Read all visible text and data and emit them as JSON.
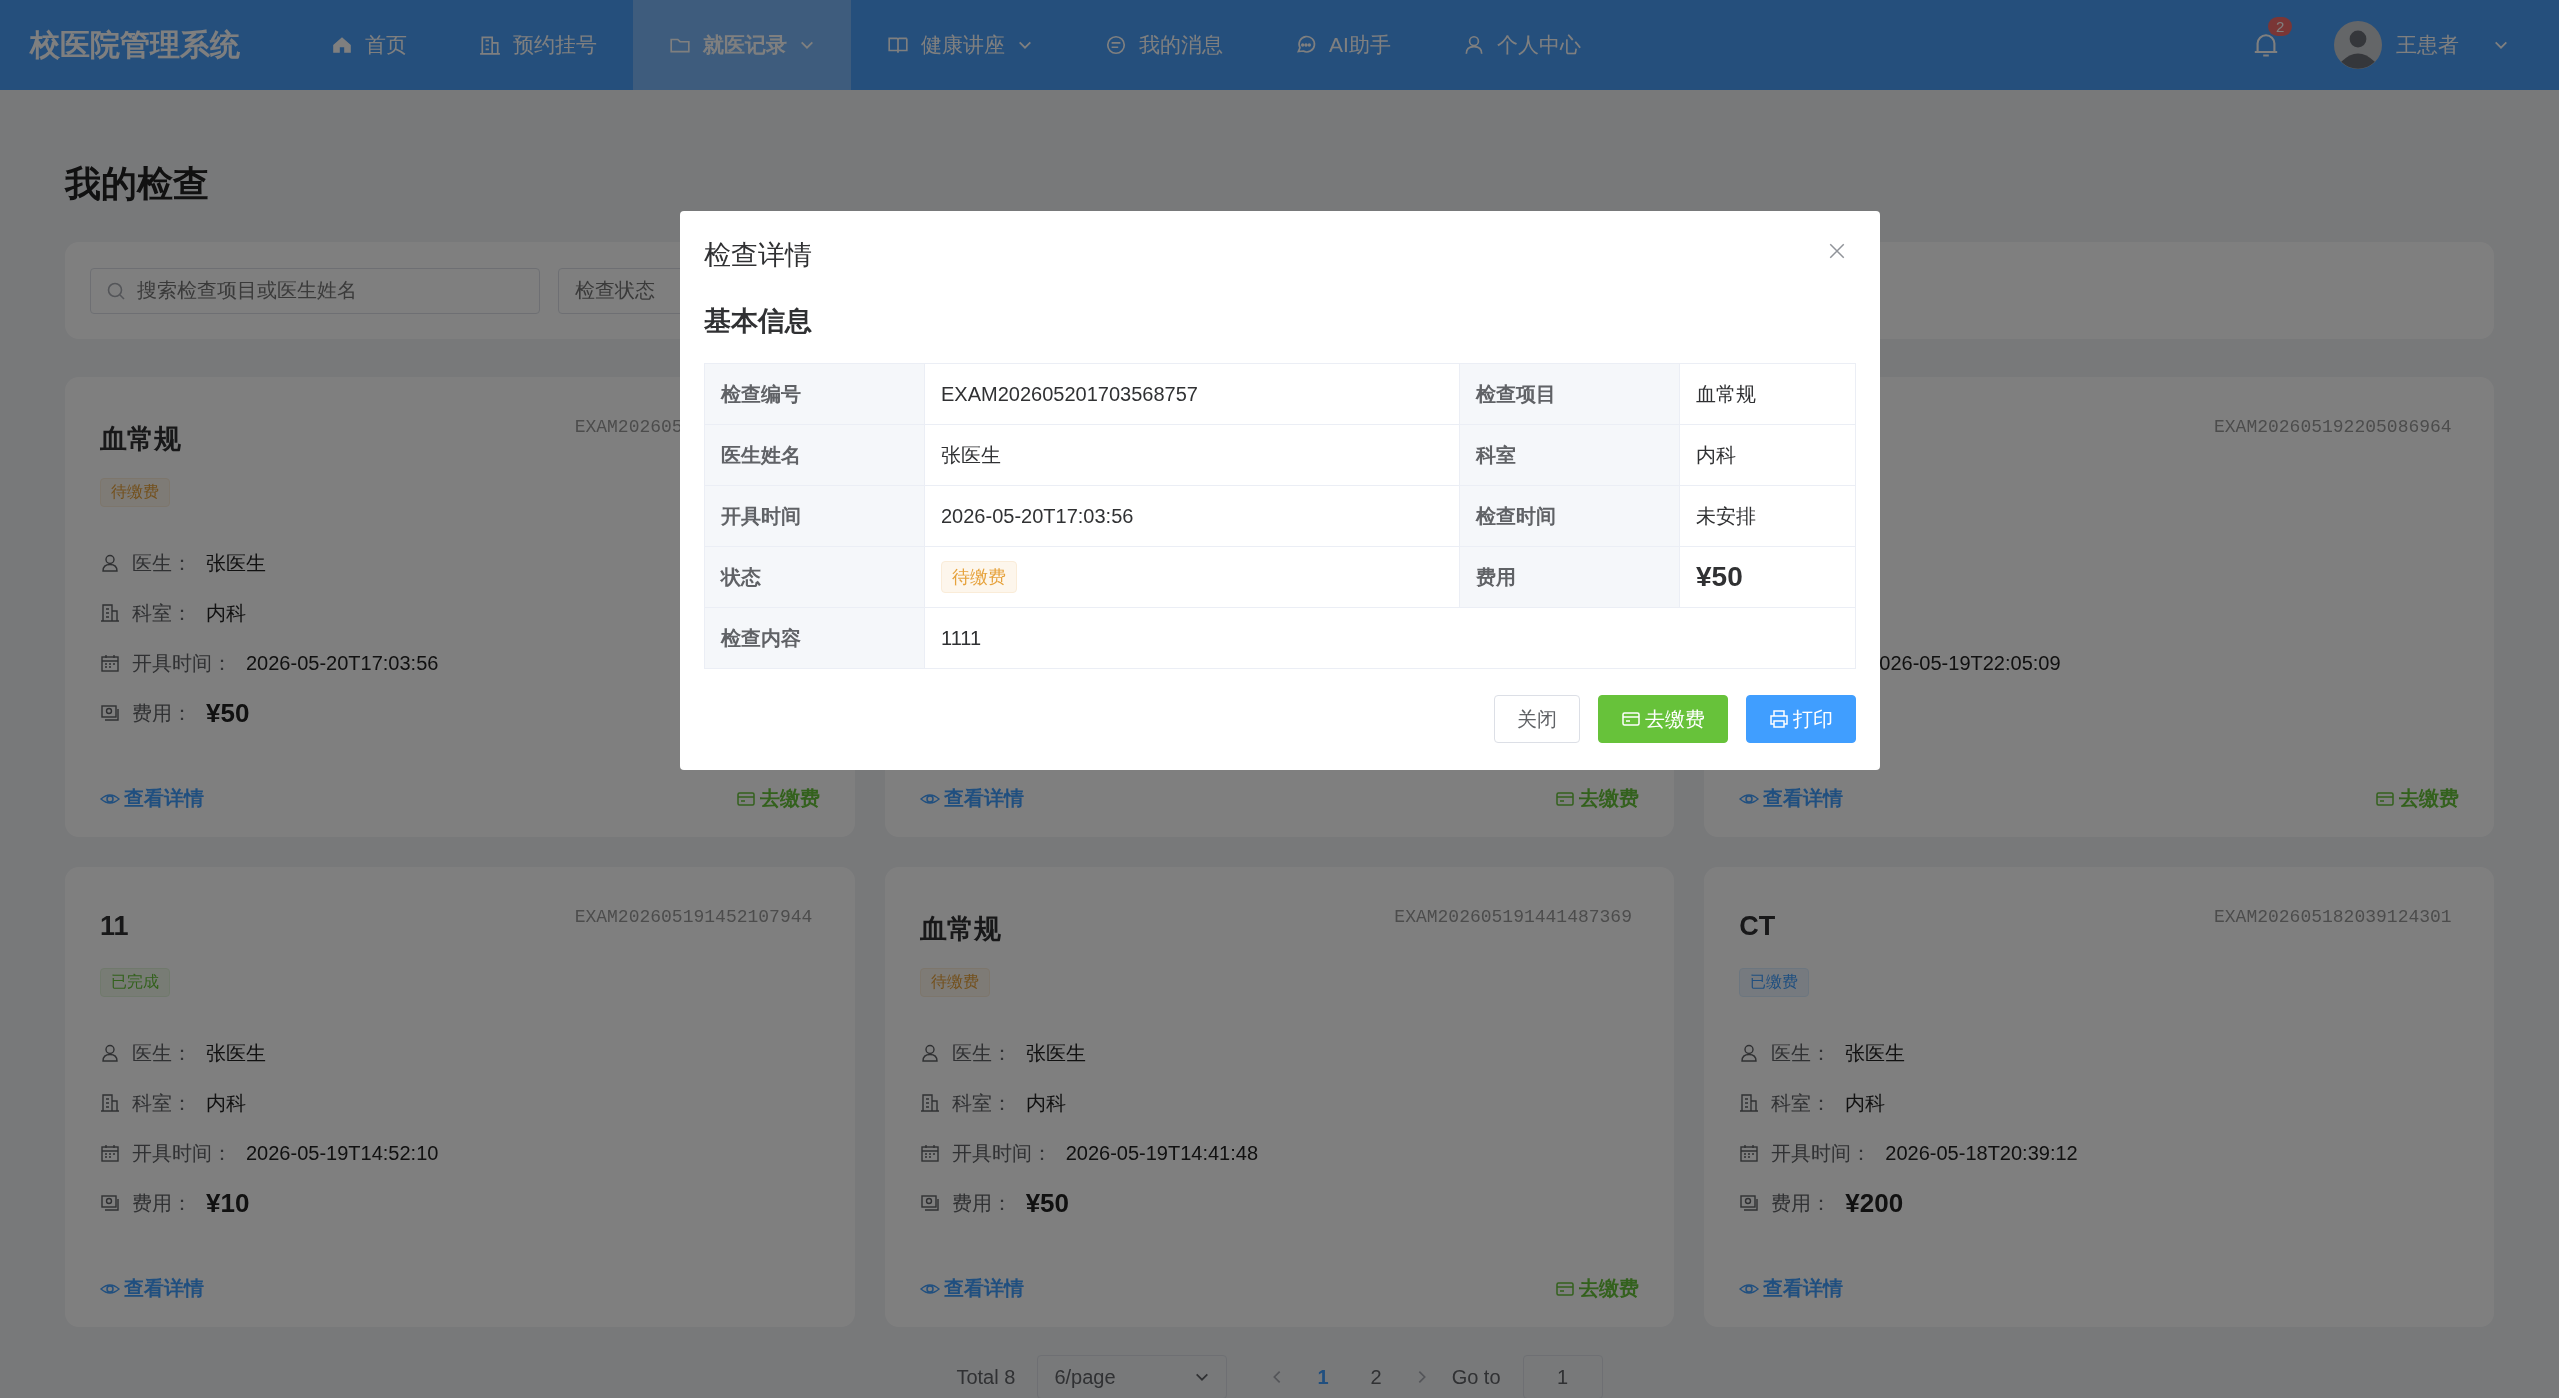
{
  "header": {
    "logo": "校医院管理系统",
    "nav": [
      {
        "label": "首页",
        "selected": false,
        "caret": false
      },
      {
        "label": "预约挂号",
        "selected": false,
        "caret": false
      },
      {
        "label": "就医记录",
        "selected": true,
        "caret": true
      },
      {
        "label": "健康讲座",
        "selected": false,
        "caret": true
      },
      {
        "label": "我的消息",
        "selected": false,
        "caret": false
      },
      {
        "label": "AI助手",
        "selected": false,
        "caret": false
      },
      {
        "label": "个人中心",
        "selected": false,
        "caret": false
      }
    ],
    "notification_count": "2",
    "user_name": "王患者"
  },
  "page_title": "我的检查",
  "filters": {
    "search": {
      "placeholder": "搜索检查项目或医生姓名"
    },
    "status_select": {
      "placeholder": "检查状态"
    }
  },
  "cards": [
    {
      "title": "血常规",
      "id": "EXAM202605",
      "status": {
        "label": "待缴费",
        "kind": "warning"
      },
      "rows": [
        {
          "kind": "doctor",
          "label": "医生：",
          "value": "张医生"
        },
        {
          "kind": "dept",
          "label": "科室：",
          "value": "内科"
        },
        {
          "kind": "time",
          "label": "开具时间：",
          "value": "2026-05-20T17:03:56"
        },
        {
          "kind": "fee",
          "label": "费用：",
          "value": "¥50"
        }
      ],
      "actions": [
        {
          "kind": "view",
          "label": "查看详情"
        },
        {
          "kind": "pay",
          "label": "去缴费"
        }
      ]
    },
    {
      "actions": [
        {
          "kind": "view",
          "label": "查看详情"
        },
        {
          "kind": "pay",
          "label": "去缴费"
        }
      ]
    },
    {
      "id": "EXAM202605192205086964",
      "rows": [
        {
          "kind": "time",
          "value": "026-05-19T22:05:09"
        }
      ],
      "actions": [
        {
          "kind": "view",
          "label": "查看详情"
        },
        {
          "kind": "pay",
          "label": "去缴费"
        }
      ]
    },
    {
      "title": "11",
      "id": "EXAM202605191452107944",
      "status": {
        "label": "已完成",
        "kind": "success"
      },
      "rows": [
        {
          "kind": "doctor",
          "label": "医生：",
          "value": "张医生"
        },
        {
          "kind": "dept",
          "label": "科室：",
          "value": "内科"
        },
        {
          "kind": "time",
          "label": "开具时间：",
          "value": "2026-05-19T14:52:10"
        },
        {
          "kind": "fee",
          "label": "费用：",
          "value": "¥10"
        }
      ],
      "actions": [
        {
          "kind": "view",
          "label": "查看详情"
        }
      ]
    },
    {
      "title": "血常规",
      "id": "EXAM202605191441487369",
      "status": {
        "label": "待缴费",
        "kind": "warning"
      },
      "rows": [
        {
          "kind": "doctor",
          "label": "医生：",
          "value": "张医生"
        },
        {
          "kind": "dept",
          "label": "科室：",
          "value": "内科"
        },
        {
          "kind": "time",
          "label": "开具时间：",
          "value": "2026-05-19T14:41:48"
        },
        {
          "kind": "fee",
          "label": "费用：",
          "value": "¥50"
        }
      ],
      "actions": [
        {
          "kind": "view",
          "label": "查看详情"
        },
        {
          "kind": "pay",
          "label": "去缴费"
        }
      ]
    },
    {
      "title": "CT",
      "id": "EXAM202605182039124301",
      "status": {
        "label": "已缴费",
        "kind": "primary"
      },
      "rows": [
        {
          "kind": "doctor",
          "label": "医生：",
          "value": "张医生"
        },
        {
          "kind": "dept",
          "label": "科室：",
          "value": "内科"
        },
        {
          "kind": "time",
          "label": "开具时间：",
          "value": "2026-05-18T20:39:12"
        },
        {
          "kind": "fee",
          "label": "费用：",
          "value": "¥200"
        }
      ],
      "actions": [
        {
          "kind": "view",
          "label": "查看详情"
        }
      ]
    }
  ],
  "pagination": {
    "total": "Total 8",
    "page_size": "6/page",
    "pages": [
      {
        "label": "1",
        "selected": true
      },
      {
        "label": "2",
        "selected": false
      }
    ],
    "goto_label": "Go to",
    "goto_value": "1"
  },
  "dialog": {
    "title": "检查详情",
    "section": "基本信息",
    "rows": [
      [
        {
          "label": "检查编号",
          "value": "EXAM202605201703568757",
          "kind": "text"
        },
        {
          "label": "检查项目",
          "value": "血常规",
          "kind": "text"
        }
      ],
      [
        {
          "label": "医生姓名",
          "value": "张医生",
          "kind": "text"
        },
        {
          "label": "科室",
          "value": "内科",
          "kind": "text"
        }
      ],
      [
        {
          "label": "开具时间",
          "value": "2026-05-20T17:03:56",
          "kind": "text"
        },
        {
          "label": "检查时间",
          "value": "未安排",
          "kind": "text"
        }
      ],
      [
        {
          "label": "状态",
          "value": "待缴费",
          "kind": "tag"
        },
        {
          "label": "费用",
          "value": "¥50",
          "kind": "price"
        }
      ],
      [
        {
          "label": "检查内容",
          "value": "1111",
          "kind": "text"
        }
      ]
    ],
    "buttons": [
      {
        "label": "关闭",
        "kind": "default"
      },
      {
        "label": "去缴费",
        "kind": "pay"
      },
      {
        "label": "打印",
        "kind": "print"
      }
    ]
  }
}
